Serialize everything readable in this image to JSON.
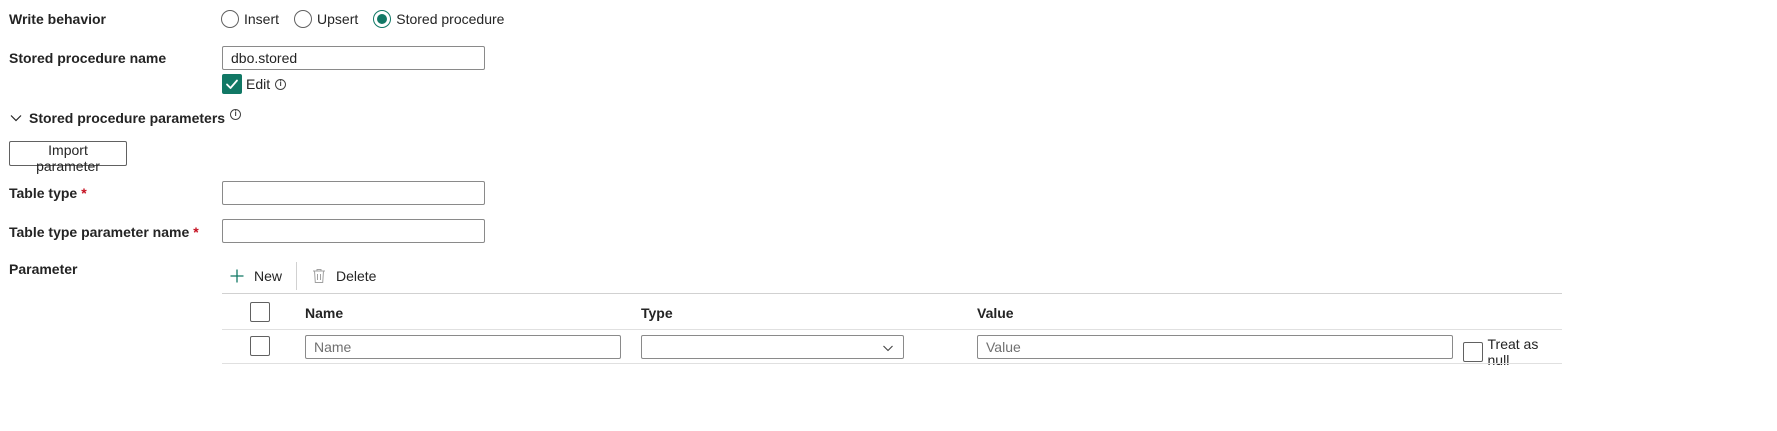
{
  "write_behavior": {
    "label": "Write behavior",
    "options": [
      {
        "label": "Insert",
        "selected": false
      },
      {
        "label": "Upsert",
        "selected": false
      },
      {
        "label": "Stored procedure",
        "selected": true
      }
    ]
  },
  "stored_procedure_name": {
    "label": "Stored procedure name",
    "value": "dbo.stored",
    "edit_label": "Edit",
    "edit_checked": true
  },
  "parameters_section": {
    "title": "Stored procedure parameters",
    "import_button": "Import parameter"
  },
  "table_type": {
    "label": "Table type",
    "required_mark": "*",
    "value": ""
  },
  "table_type_param": {
    "label": "Table type parameter name",
    "required_mark": "*",
    "value": ""
  },
  "parameter": {
    "label": "Parameter",
    "toolbar": {
      "new_label": "New",
      "delete_label": "Delete"
    },
    "columns": {
      "name": "Name",
      "type": "Type",
      "value": "Value"
    },
    "row": {
      "name_placeholder": "Name",
      "type_value": "",
      "value_placeholder": "Value",
      "null_label": "Treat as null"
    }
  },
  "colors": {
    "accent": "#117865",
    "required": "#c50f1f"
  }
}
